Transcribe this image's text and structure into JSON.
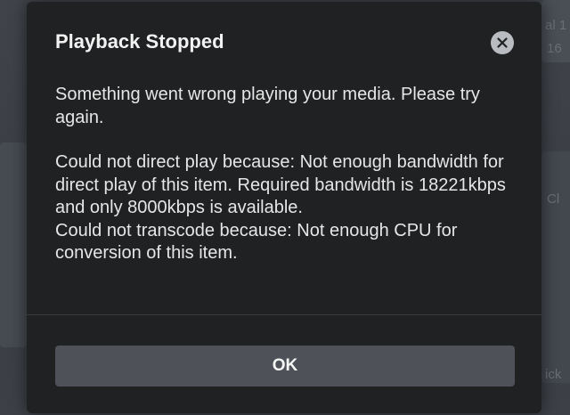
{
  "dialog": {
    "title": "Playback Stopped",
    "message": "Something went wrong playing your media. Please try again.",
    "detail_direct_play": "Could not direct play because: Not enough bandwidth for direct play of this item. Required bandwidth is 18221kbps and only 8000kbps is available.",
    "detail_transcode": "Could not transcode because: Not enough CPU for conversion of this item.",
    "ok_label": "OK",
    "close_icon": "close-icon"
  },
  "background": {
    "fragment_top_right": "al 1",
    "fragment_top_right_2": "16",
    "fragment_mid_right": "Cl",
    "fragment_bottom_right": "ick"
  }
}
